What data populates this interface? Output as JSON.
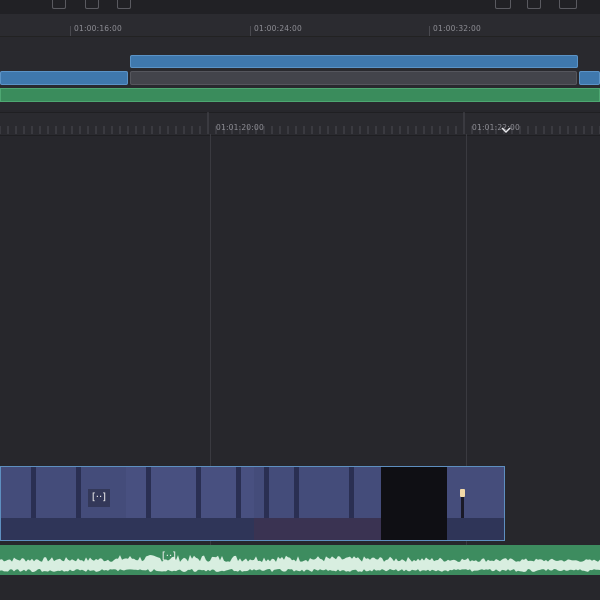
{
  "toolbar": {
    "icons": [
      "clip-icon",
      "trim-icon",
      "blade-icon",
      "timeline-view-icon",
      "image-icon",
      "waveform-icon"
    ]
  },
  "mini_timeline": {
    "timecodes": [
      "01:00:16:00",
      "01:00:24:00",
      "01:00:32:00"
    ]
  },
  "main_timeline": {
    "timecodes": [
      "01:01:20:00",
      "01:01:22:00"
    ]
  },
  "video_clip": {
    "markers": [
      "[··]"
    ]
  },
  "audio_clip": {
    "markers": [
      "[··]"
    ]
  },
  "colors": {
    "video_track": "#3f78ad",
    "audio_track": "#3a8c5c",
    "background": "#27272c"
  }
}
